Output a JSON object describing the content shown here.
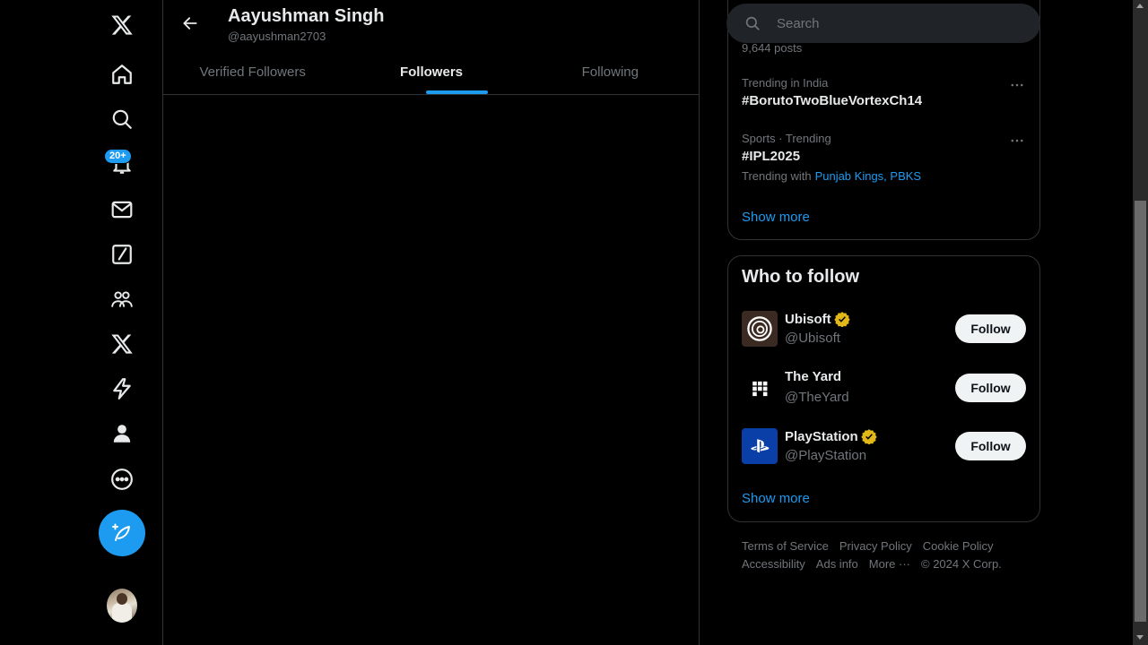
{
  "nav": {
    "items": [
      {
        "name": "x-logo-icon"
      },
      {
        "name": "home-icon"
      },
      {
        "name": "explore-icon"
      },
      {
        "name": "notifications-icon"
      },
      {
        "name": "messages-icon"
      },
      {
        "name": "grok-icon"
      },
      {
        "name": "communities-icon"
      },
      {
        "name": "premium-icon"
      },
      {
        "name": "verified-orgs-icon"
      },
      {
        "name": "profile-icon"
      },
      {
        "name": "more-icon"
      }
    ],
    "notification_badge": "20+",
    "post_button_icon": "compose-icon"
  },
  "profile": {
    "name": "Aayushman Singh",
    "handle": "@aayushman2703"
  },
  "tabs": [
    {
      "label": "Verified Followers",
      "active": false
    },
    {
      "label": "Followers",
      "active": true
    },
    {
      "label": "Following",
      "active": false
    }
  ],
  "search": {
    "placeholder": "Search"
  },
  "trends": {
    "partial_posts": "9,644 posts",
    "items": [
      {
        "meta": "Trending in India",
        "title": "#BorutoTwoBlueVortexCh14"
      },
      {
        "meta": "Sports · Trending",
        "title": "#IPL2025",
        "trending_with_label": "Trending with",
        "trending_with_links": "Punjab Kings, PBKS"
      }
    ],
    "show_more": "Show more"
  },
  "who_to_follow": {
    "title": "Who to follow",
    "accounts": [
      {
        "name": "Ubisoft",
        "handle": "@Ubisoft",
        "verified": true,
        "button": "Follow"
      },
      {
        "name": "The Yard",
        "handle": "@TheYard",
        "verified": false,
        "button": "Follow"
      },
      {
        "name": "PlayStation",
        "handle": "@PlayStation",
        "verified": true,
        "button": "Follow"
      }
    ],
    "show_more": "Show more"
  },
  "footer": {
    "links": [
      "Terms of Service",
      "Privacy Policy",
      "Cookie Policy",
      "Accessibility",
      "Ads info",
      "More ···"
    ],
    "copyright": "© 2024 X Corp."
  },
  "colors": {
    "accent": "#1d9bf0",
    "background": "#000000",
    "border": "#2f3336",
    "muted_text": "#71767b",
    "verified_gold": "#e2b719"
  }
}
